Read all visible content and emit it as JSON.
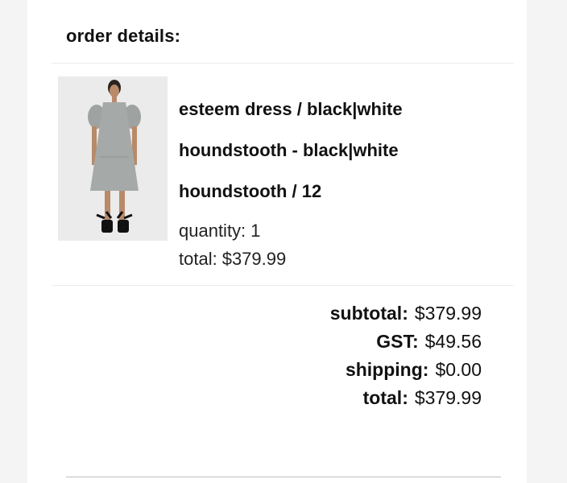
{
  "order": {
    "heading": "order details:",
    "item": {
      "name_line1": "esteem dress / black|white",
      "name_line2": "houndstooth - black|white",
      "name_line3": "houndstooth / 12",
      "quantity_label": "quantity:",
      "quantity": "1",
      "total_label": "total:",
      "total": "$379.99"
    },
    "summary": {
      "subtotal_label": "subtotal:",
      "subtotal": "$379.99",
      "gst_label": "GST:",
      "gst": "$49.56",
      "shipping_label": "shipping:",
      "shipping": "$0.00",
      "total_label": "total:",
      "total": "$379.99"
    }
  }
}
